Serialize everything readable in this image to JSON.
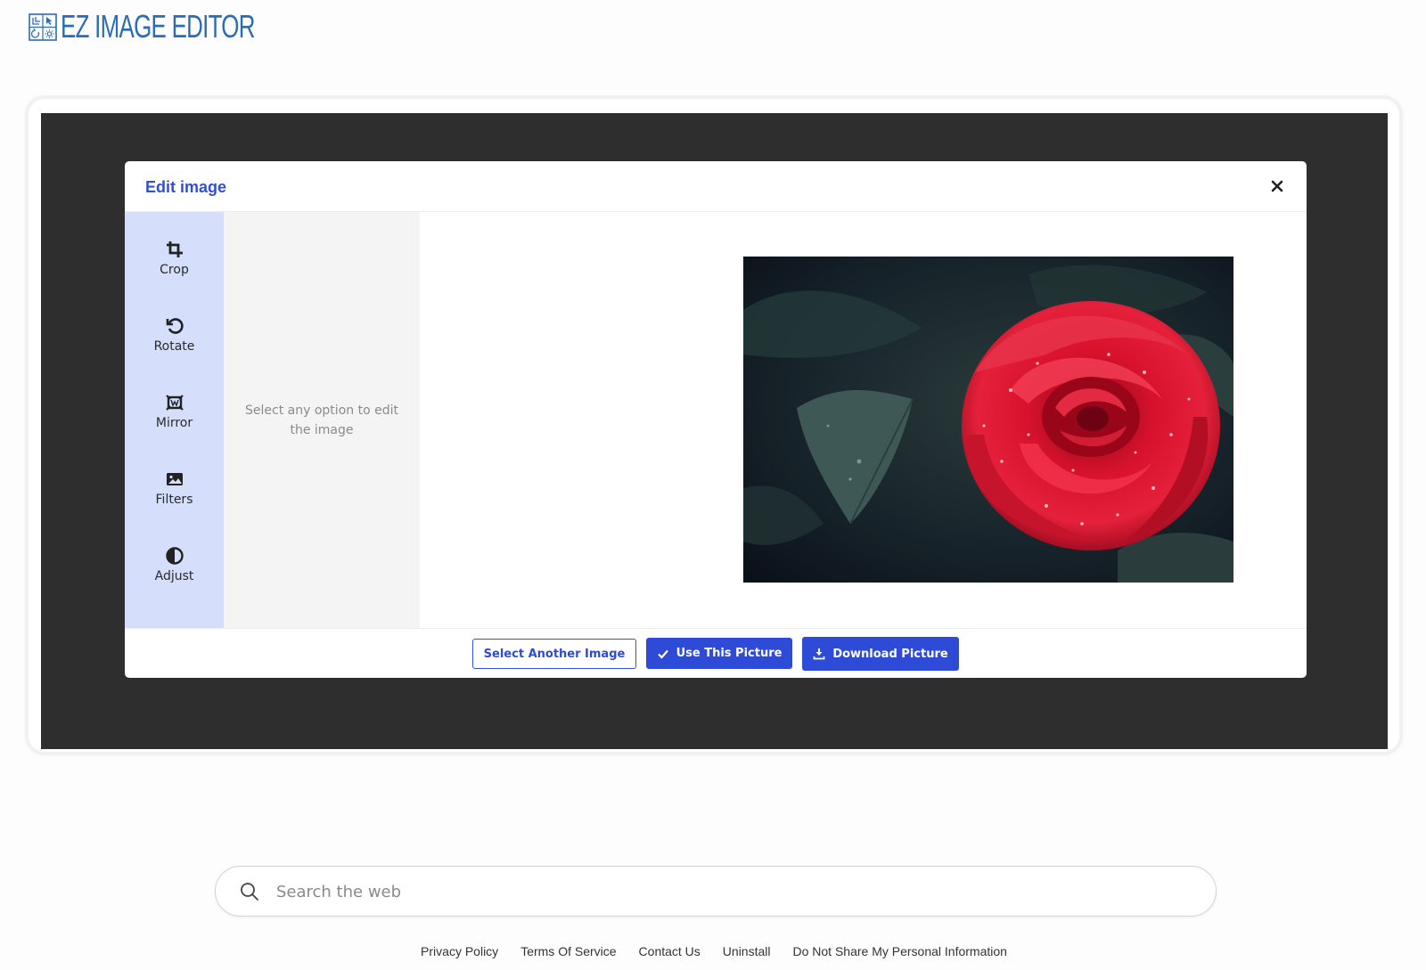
{
  "header": {
    "logo_text": "EZ IMAGE EDITOR",
    "logo_icon": "image-editor-logo-icon"
  },
  "modal": {
    "title": "Edit image",
    "close_icon": "close-icon",
    "tools": [
      {
        "label": "Crop",
        "icon": "crop-icon"
      },
      {
        "label": "Rotate",
        "icon": "rotate-icon"
      },
      {
        "label": "Mirror",
        "icon": "mirror-icon"
      },
      {
        "label": "Filters",
        "icon": "image-icon"
      },
      {
        "label": "Adjust",
        "icon": "contrast-icon"
      }
    ],
    "options_hint": "Select any option to edit the image",
    "preview_description_icon": "rose-photo",
    "buttons": {
      "select_another": "Select Another Image",
      "use_picture": "Use This Picture",
      "download": "Download Picture"
    }
  },
  "search": {
    "placeholder": "Search the web",
    "value": ""
  },
  "footer": {
    "links": [
      "Privacy Policy",
      "Terms Of Service",
      "Contact Us",
      "Uninstall",
      "Do Not Share My Personal Information"
    ]
  },
  "colors": {
    "brand_blue": "#2b6cb5",
    "primary_button": "#2e4bd8",
    "toolbar_bg": "#d5dffb",
    "stage_bg": "#2e2e2e"
  }
}
